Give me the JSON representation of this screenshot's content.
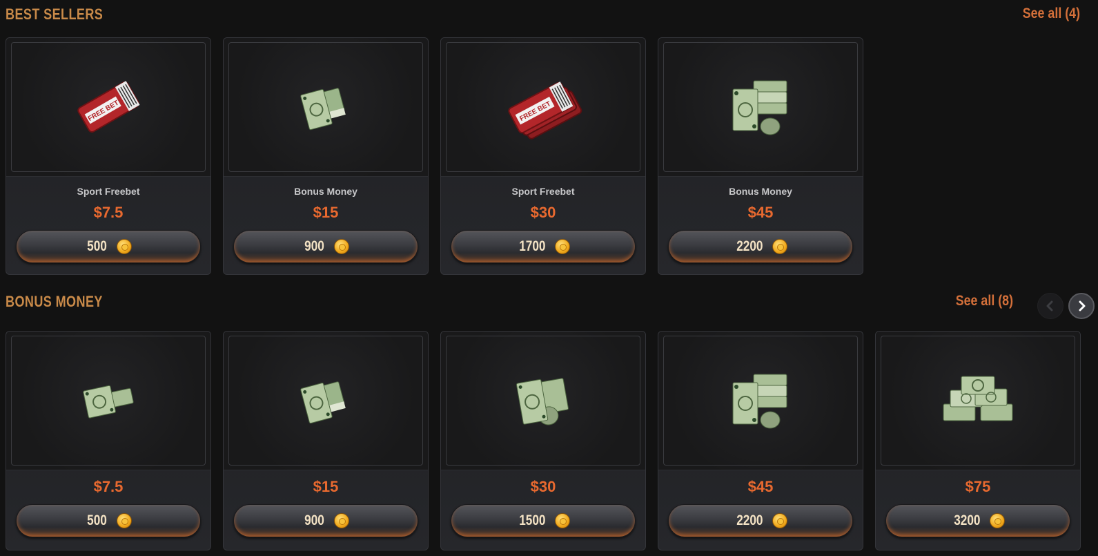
{
  "best_sellers": {
    "title": "BEST SELLERS",
    "see_all": "See all (4)",
    "items": [
      {
        "name": "Sport Freebet",
        "price": "$7.5",
        "cost": "500",
        "image": "freebet-ticket-icon"
      },
      {
        "name": "Bonus Money",
        "price": "$15",
        "cost": "900",
        "image": "cash-stack-icon"
      },
      {
        "name": "Sport Freebet",
        "price": "$30",
        "cost": "1700",
        "image": "freebet-tickets-icon"
      },
      {
        "name": "Bonus Money",
        "price": "$45",
        "cost": "2200",
        "image": "cash-pile-icon"
      }
    ]
  },
  "bonus_money": {
    "title": "BONUS MONEY",
    "see_all": "See all (8)",
    "items": [
      {
        "price": "$7.5",
        "cost": "500",
        "image": "cash-small-icon"
      },
      {
        "price": "$15",
        "cost": "900",
        "image": "cash-stack-icon"
      },
      {
        "price": "$30",
        "cost": "1500",
        "image": "cash-roll-icon"
      },
      {
        "price": "$45",
        "cost": "2200",
        "image": "cash-pile-icon"
      },
      {
        "price": "$75",
        "cost": "3200",
        "image": "cash-heap-icon"
      }
    ]
  },
  "colors": {
    "background": "#121212",
    "section_title": "#c98a49",
    "see_all": "#d4703a",
    "price": "#e8692f",
    "button_text": "#f3e2c4",
    "coin": "#f0a81a"
  }
}
